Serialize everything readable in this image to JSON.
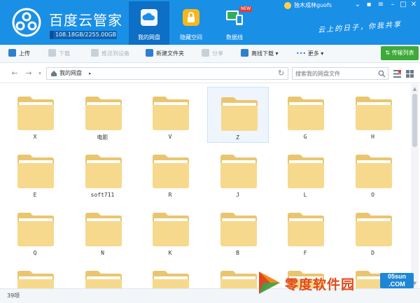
{
  "app": {
    "title": "百度云管家",
    "storage_text": "108.18GB/2255.00GB",
    "storage_used_fraction": 0.048,
    "user_name": "独木成林guofs",
    "slogan": "云上的日子，你我共享"
  },
  "nav_tabs": [
    {
      "label": "我的网盘",
      "active": true,
      "icon": "cloud-drive-icon"
    },
    {
      "label": "隐藏空间",
      "active": false,
      "icon": "lock-icon"
    },
    {
      "label": "数据线",
      "active": false,
      "icon": "data-cable-icon",
      "badge": "NEW"
    }
  ],
  "toolbar": {
    "upload": "上传",
    "download": "下载",
    "push_device": "推送到设备",
    "new_folder": "新建文件夹",
    "share": "分享",
    "offline_download": "离线下载",
    "more": "更多",
    "transfer_list": "传输列表"
  },
  "address": {
    "path": "我的网盘",
    "search_placeholder": "搜索我的网盘文件"
  },
  "folders": [
    {
      "name": "X"
    },
    {
      "name": "电影"
    },
    {
      "name": "V"
    },
    {
      "name": "Z",
      "selected": true
    },
    {
      "name": "G"
    },
    {
      "name": "H"
    },
    {
      "name": "E"
    },
    {
      "name": "soft711"
    },
    {
      "name": "R"
    },
    {
      "name": "J"
    },
    {
      "name": "L"
    },
    {
      "name": "O"
    },
    {
      "name": "Q"
    },
    {
      "name": "N"
    },
    {
      "name": "K"
    },
    {
      "name": "B"
    },
    {
      "name": "F"
    },
    {
      "name": "D"
    },
    {
      "name": ""
    },
    {
      "name": ""
    },
    {
      "name": ""
    },
    {
      "name": ""
    },
    {
      "name": ""
    },
    {
      "name": ""
    }
  ],
  "status": {
    "count": "39项"
  },
  "watermark": {
    "text": "零度软件园",
    "site": "05sun",
    "site_tld": ".COM"
  },
  "colors": {
    "header_blue": "#1a8fe6",
    "active_tab": "#0d6fc6",
    "folder_yellow": "#f6d98c",
    "transfer_green": "#3daa3a"
  }
}
